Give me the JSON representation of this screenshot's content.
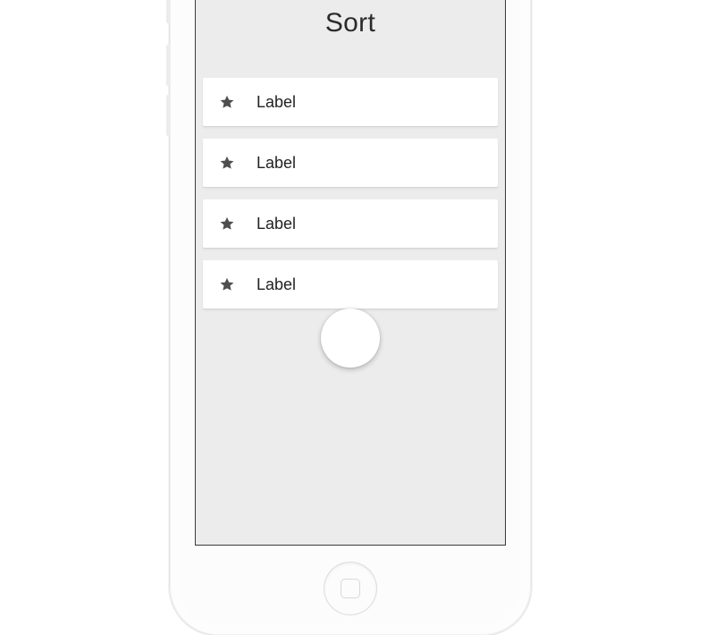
{
  "title": "Sort",
  "rows": [
    {
      "icon": "star-icon",
      "label": "Label"
    },
    {
      "icon": "star-icon",
      "label": "Label"
    },
    {
      "icon": "star-icon",
      "label": "Label"
    },
    {
      "icon": "star-icon",
      "label": "Label"
    }
  ]
}
